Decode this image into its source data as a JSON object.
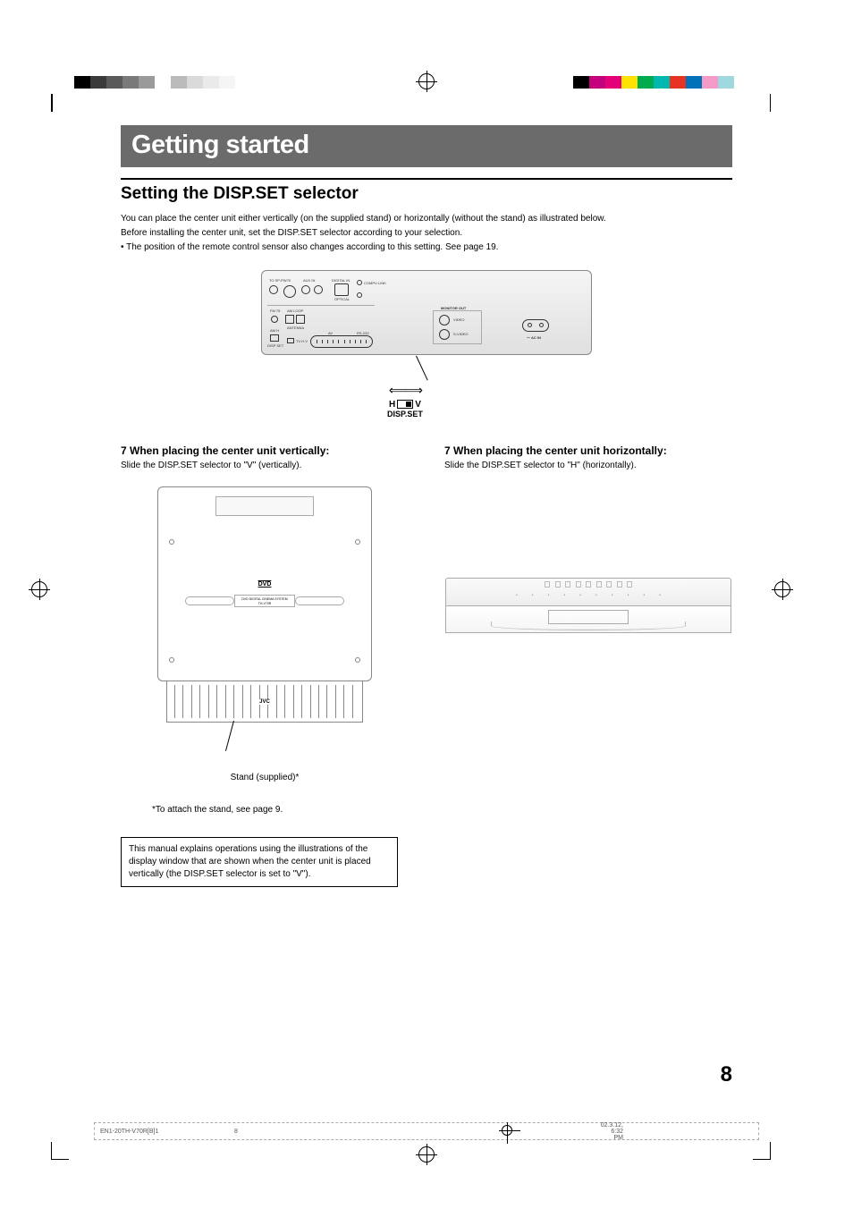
{
  "reg_colors_left": [
    "#000000",
    "#3a3a3a",
    "#5a5a5a",
    "#7a7a7a",
    "#9a9a9a",
    "#ffffff",
    "#bababa",
    "#dadada",
    "#eaeaea",
    "#f5f5f5",
    "#ffffff"
  ],
  "reg_colors_right": [
    "#000000",
    "#c5007c",
    "#e30079",
    "#ffe200",
    "#00aa4f",
    "#00b8b0",
    "#e73323",
    "#0070b8",
    "#f39ac6",
    "#a0d8e0",
    "#ffffff"
  ],
  "title": "Getting started",
  "section_heading": "Setting the DISP.SET selector",
  "intro_line1": "You can place the center unit either vertically (on the supplied stand) or horizontally (without the stand) as illustrated below.",
  "intro_line2": "Before installing the center unit, set the DISP.SET selector according to your selection.",
  "intro_bullet": "• The position of the remote control sensor also changes according to this setting. See page 19.",
  "back_panel": {
    "labels": [
      "TO SP-PW70",
      "AUX IN",
      "DIGITAL IN",
      "COMPU LINK",
      "OPTICAL",
      "MONITOR OUT",
      "VIDEO",
      "S-VIDEO",
      "AC IN",
      "ANTENNA",
      "AM H",
      "FM 75",
      "AM LOOP",
      "AV",
      "RS-232",
      "DISP SET",
      "TV H V"
    ],
    "disp_set_h": "H",
    "disp_set_v": "V",
    "disp_set_label": "DISP.SET"
  },
  "left_col": {
    "heading": "7 When placing the center unit vertically:",
    "text": "Slide the DISP.SET selector to \"V\" (vertically).",
    "dvd_logo": "DVD",
    "slot_text1": "DVD DIGITAL CINEMA SYSTEM",
    "slot_text2": "TH-V70R",
    "stand_brand": "JVC",
    "stand_caption": "Stand (supplied)*",
    "footnote": "*To attach the stand, see page 9.",
    "note_box": "This manual explains operations using the illustrations of the display window that are shown when the center unit is placed vertically (the DISP.SET selector is set to \"V\")."
  },
  "right_col": {
    "heading": "7 When placing the center unit horizontally:",
    "text": "Slide the DISP.SET selector to \"H\" (horizontally)."
  },
  "page_number": "8",
  "footer": {
    "file": "EN1-20TH-V70R[B]1",
    "page": "8",
    "timestamp": "02.3.12, 6:32 PM"
  }
}
